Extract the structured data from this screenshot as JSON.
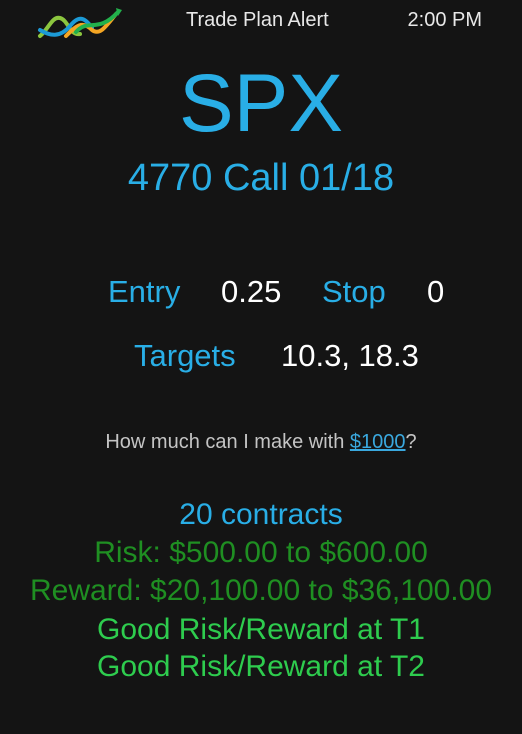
{
  "header": {
    "logo_icon": "trend-chart-logo-icon",
    "title": "Trade Plan Alert",
    "time": "2:00 PM"
  },
  "trade": {
    "symbol": "SPX",
    "contract": "4770 Call 01/18",
    "entry_label": "Entry",
    "entry_value": "0.25",
    "stop_label": "Stop",
    "stop_value": "0",
    "targets_label": "Targets",
    "targets_value": "10.3, 18.3"
  },
  "question": {
    "prefix": "How much can I make with ",
    "link": "$1000",
    "suffix": "?"
  },
  "results": {
    "contracts": "20 contracts",
    "risk": "Risk: $500.00 to $600.00",
    "reward": "Reward: $20,100.00 to $36,100.00",
    "t1": "Good Risk/Reward at T1",
    "t2": "Good Risk/Reward at T2"
  },
  "colors": {
    "background": "#141414",
    "accent_blue": "#29aee6",
    "risk_green_dark": "#1f8f22",
    "good_green": "#2ecc4e"
  }
}
